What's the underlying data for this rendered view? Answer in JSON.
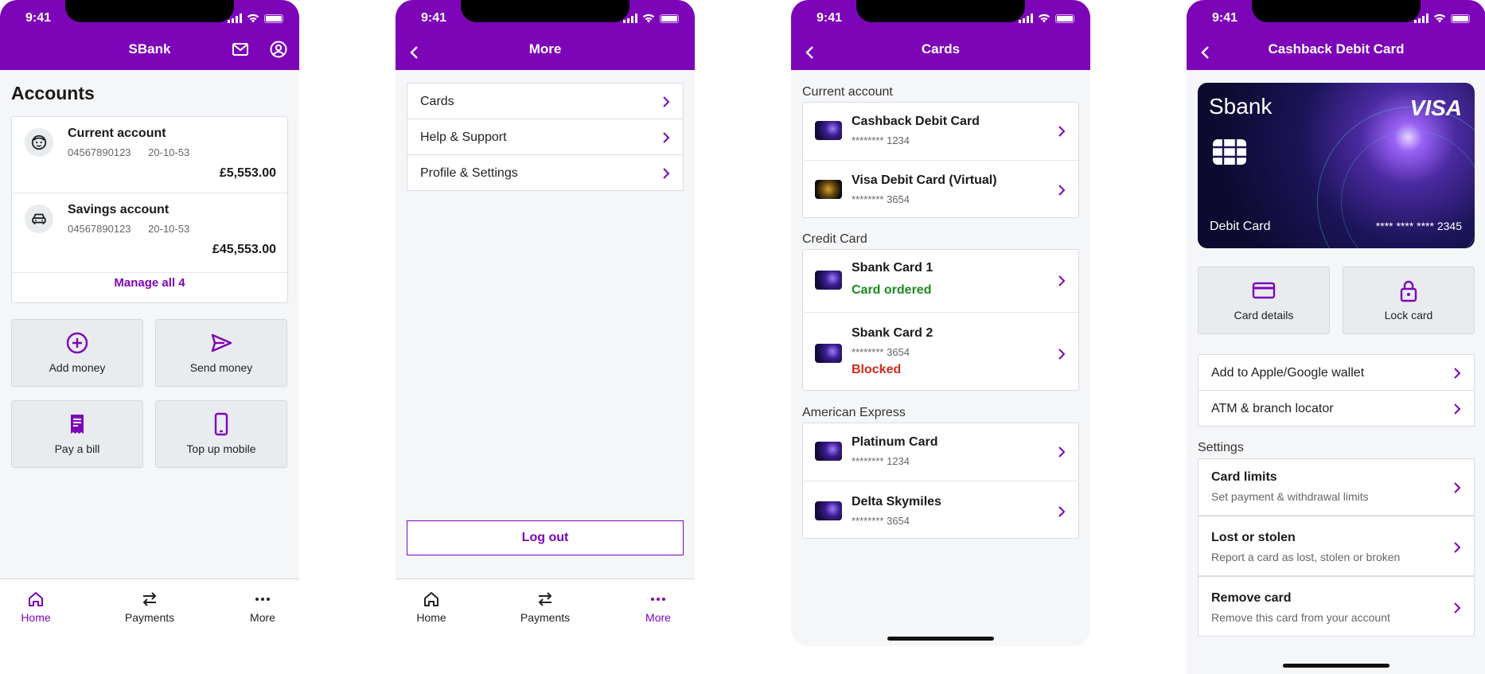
{
  "status": {
    "time": "9:41"
  },
  "screens": {
    "home": {
      "header_title": "SBank",
      "heading": "Accounts",
      "accounts": [
        {
          "name": "Current account",
          "number": "04567890123",
          "sort_code": "20-10-53",
          "balance": "£5,553.00",
          "icon": "face-icon"
        },
        {
          "name": "Savings account",
          "number": "04567890123",
          "sort_code": "20-10-53",
          "balance": "£45,553.00",
          "icon": "car-icon"
        }
      ],
      "manage_label": "Manage all 4",
      "actions": [
        {
          "label": "Add money",
          "icon": "plus-circle-icon"
        },
        {
          "label": "Send money",
          "icon": "send-icon"
        },
        {
          "label": "Pay a bill",
          "icon": "bill-icon"
        },
        {
          "label": "Top up mobile",
          "icon": "mobile-icon"
        }
      ]
    },
    "more": {
      "header_title": "More",
      "items": [
        {
          "label": "Cards"
        },
        {
          "label": "Help & Support"
        },
        {
          "label": "Profile & Settings"
        }
      ],
      "logout_label": "Log out"
    },
    "cards": {
      "header_title": "Cards",
      "sections": [
        {
          "title": "Current account",
          "cards": [
            {
              "name": "Cashback Debit Card",
              "number": "******** 1234"
            },
            {
              "name": "Visa Debit Card (Virtual)",
              "number": "******** 3654"
            }
          ]
        },
        {
          "title": "Credit Card",
          "cards": [
            {
              "name": "Sbank Card 1",
              "status": "Card ordered"
            },
            {
              "name": "Sbank Card 2",
              "number": "******** 3654",
              "status": "Blocked"
            }
          ]
        },
        {
          "title": "American Express",
          "cards": [
            {
              "name": "Platinum Card",
              "number": "******** 1234"
            },
            {
              "name": "Delta Skymiles",
              "number": "******** 3654"
            }
          ]
        }
      ]
    },
    "card_detail": {
      "header_title": "Cashback Debit Card",
      "card": {
        "brand": "Sbank",
        "network": "VISA",
        "type": "Debit Card",
        "number": "**** **** **** 2345"
      },
      "actions": [
        {
          "label": "Card details",
          "icon": "card-icon"
        },
        {
          "label": "Lock card",
          "icon": "lock-icon"
        }
      ],
      "links": [
        {
          "label": "Add to Apple/Google wallet"
        },
        {
          "label": "ATM & branch locator"
        }
      ],
      "settings_title": "Settings",
      "settings": [
        {
          "title": "Card limits",
          "subtitle": "Set payment & withdrawal limits"
        },
        {
          "title": "Lost or stolen",
          "subtitle": "Report a card as lost, stolen or broken"
        },
        {
          "title": "Remove card",
          "subtitle": "Remove this card from your account"
        }
      ]
    }
  },
  "tabbar": {
    "home": "Home",
    "payments": "Payments",
    "more": "More"
  },
  "colors": {
    "brand": "#7d05b8",
    "success": "#1f8a1f",
    "danger": "#d02b1d"
  }
}
